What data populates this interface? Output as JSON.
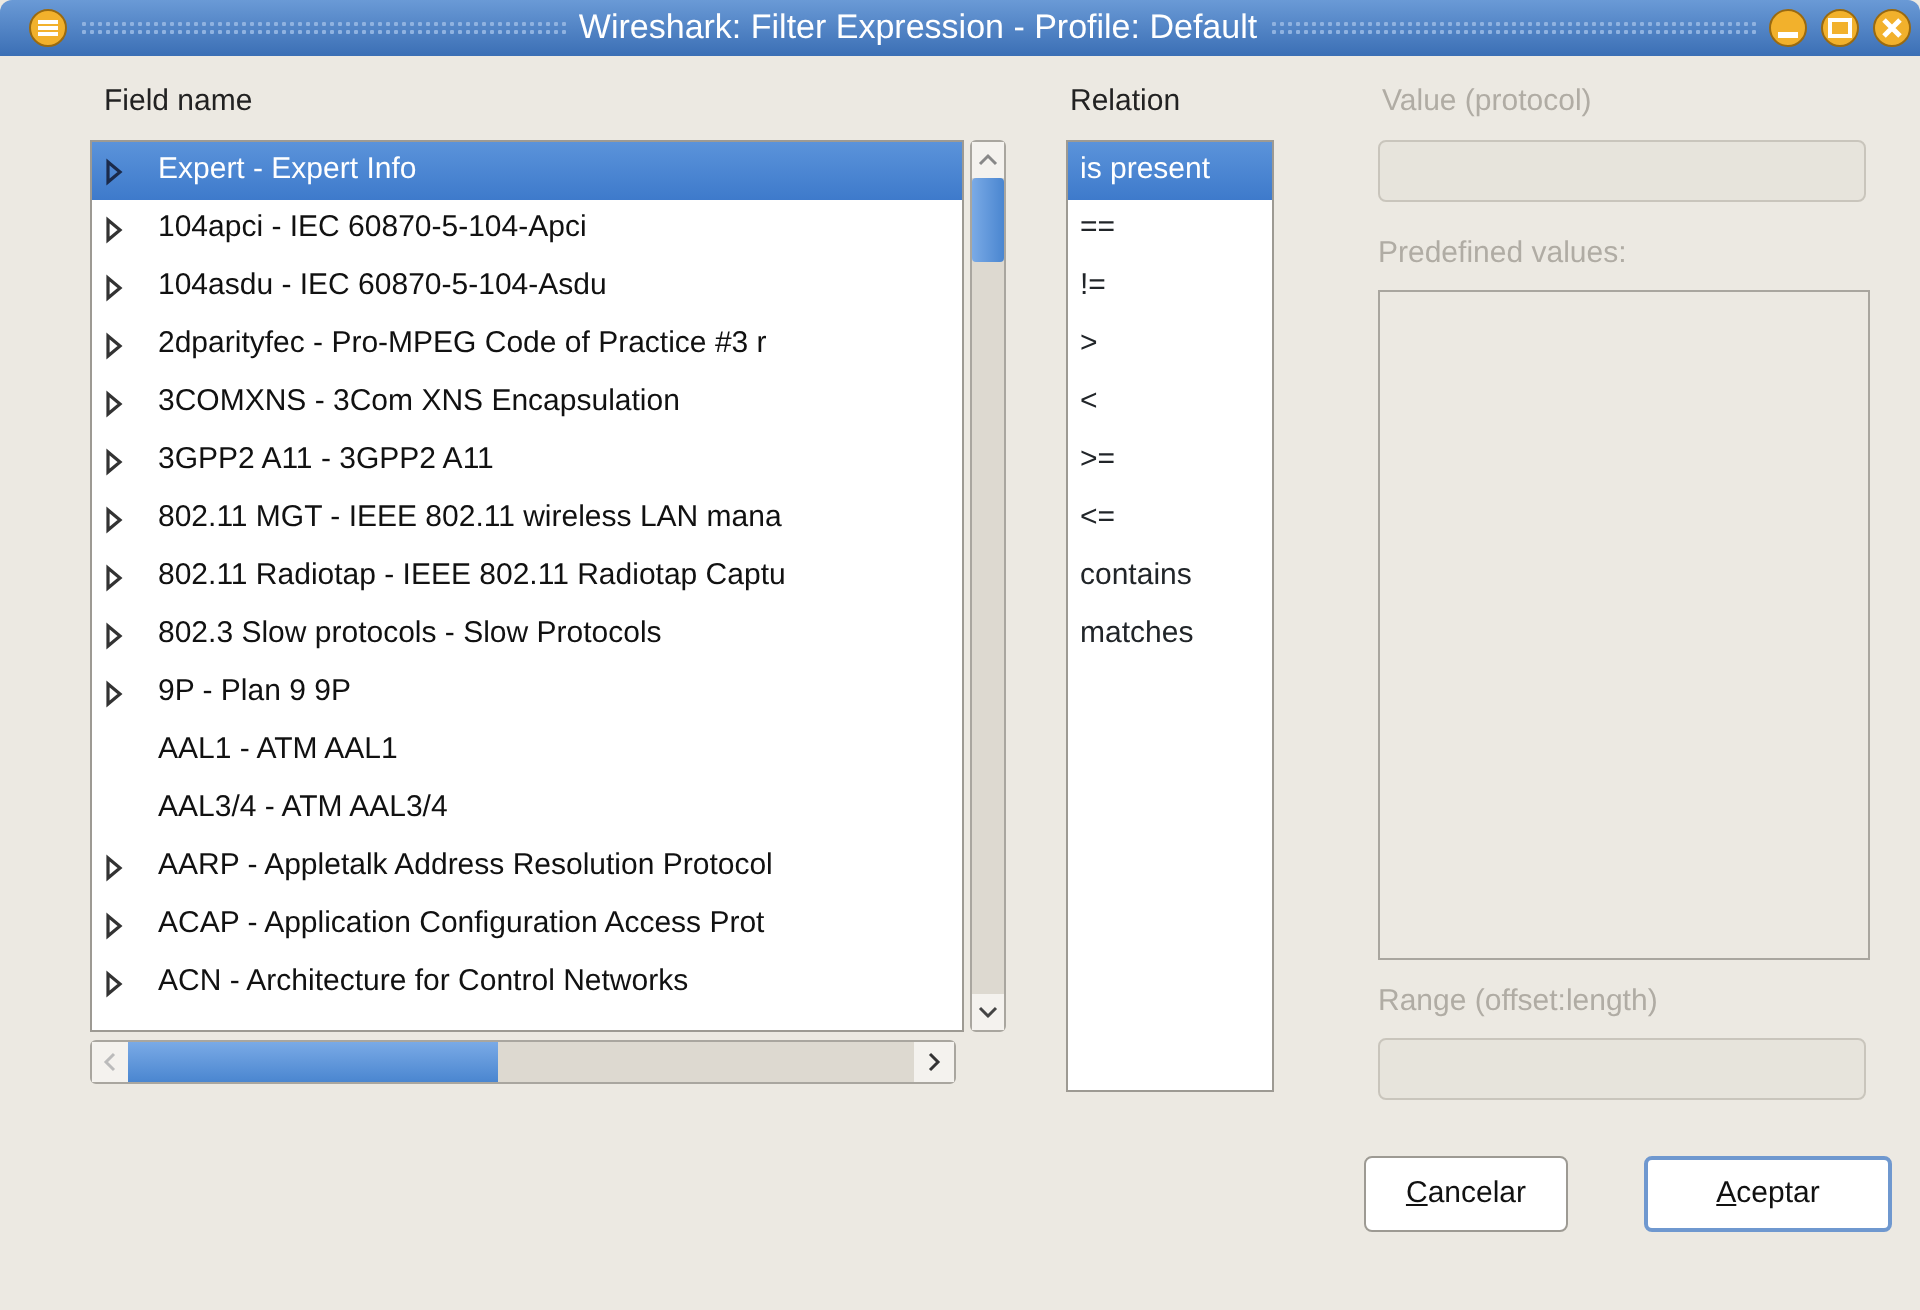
{
  "window": {
    "title": "Wireshark: Filter Expression - Profile: Default"
  },
  "field_name": {
    "label": "Field name",
    "items": [
      {
        "label": "Expert - Expert Info",
        "expandable": true,
        "selected": true
      },
      {
        "label": "104apci - IEC 60870-5-104-Apci",
        "expandable": true,
        "selected": false
      },
      {
        "label": "104asdu - IEC 60870-5-104-Asdu",
        "expandable": true,
        "selected": false
      },
      {
        "label": "2dparityfec - Pro-MPEG Code of Practice #3 r",
        "expandable": true,
        "selected": false
      },
      {
        "label": "3COMXNS - 3Com XNS Encapsulation",
        "expandable": true,
        "selected": false
      },
      {
        "label": "3GPP2 A11 - 3GPP2 A11",
        "expandable": true,
        "selected": false
      },
      {
        "label": "802.11 MGT - IEEE 802.11 wireless LAN mana",
        "expandable": true,
        "selected": false
      },
      {
        "label": "802.11 Radiotap - IEEE 802.11 Radiotap Captu",
        "expandable": true,
        "selected": false
      },
      {
        "label": "802.3 Slow protocols - Slow Protocols",
        "expandable": true,
        "selected": false
      },
      {
        "label": "9P - Plan 9 9P",
        "expandable": true,
        "selected": false
      },
      {
        "label": "AAL1 - ATM AAL1",
        "expandable": false,
        "selected": false
      },
      {
        "label": "AAL3/4 - ATM AAL3/4",
        "expandable": false,
        "selected": false
      },
      {
        "label": "AARP - Appletalk Address Resolution Protocol",
        "expandable": true,
        "selected": false
      },
      {
        "label": "ACAP - Application Configuration Access Prot",
        "expandable": true,
        "selected": false
      },
      {
        "label": "ACN - Architecture for Control Networks",
        "expandable": true,
        "selected": false
      }
    ]
  },
  "relation": {
    "label": "Relation",
    "items": [
      {
        "label": "is present",
        "selected": true
      },
      {
        "label": "==",
        "selected": false
      },
      {
        "label": "!=",
        "selected": false
      },
      {
        "label": ">",
        "selected": false
      },
      {
        "label": "<",
        "selected": false
      },
      {
        "label": ">=",
        "selected": false
      },
      {
        "label": "<=",
        "selected": false
      },
      {
        "label": "contains",
        "selected": false
      },
      {
        "label": "matches",
        "selected": false
      }
    ]
  },
  "value": {
    "label": "Value (protocol)",
    "disabled": true
  },
  "predefined_values": {
    "label": "Predefined values:",
    "disabled": true
  },
  "range": {
    "label": "Range (offset:length)",
    "disabled": true
  },
  "buttons": [
    {
      "label": "Cancelar",
      "mnemonic": true,
      "default": false
    },
    {
      "label": "Aceptar",
      "mnemonic": true,
      "default": true
    }
  ]
}
